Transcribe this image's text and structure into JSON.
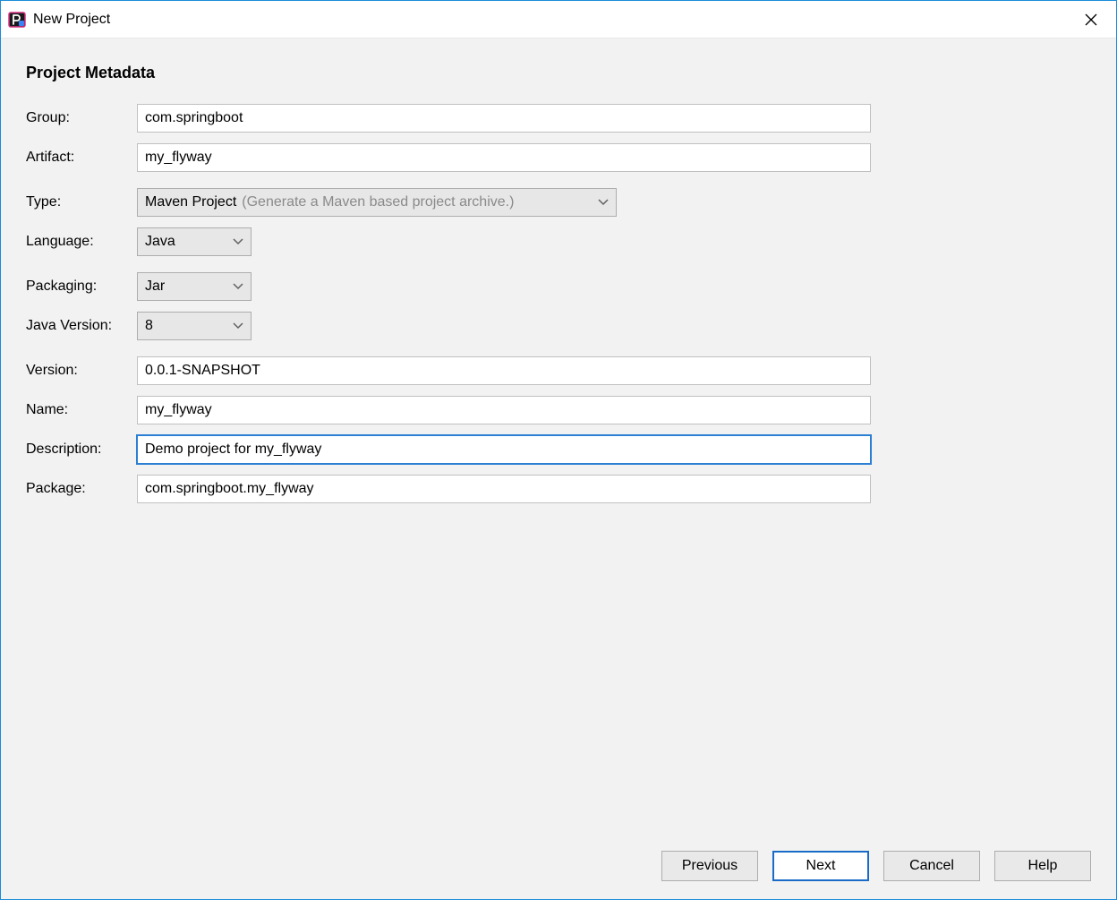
{
  "window": {
    "title": "New Project"
  },
  "section_title": "Project Metadata",
  "labels": {
    "group": "Group:",
    "artifact": "Artifact:",
    "type": "Type:",
    "language": "Language:",
    "packaging": "Packaging:",
    "java_version": "Java Version:",
    "version": "Version:",
    "name": "Name:",
    "description": "Description:",
    "package": "Package:"
  },
  "fields": {
    "group": "com.springboot",
    "artifact": "my_flyway",
    "type_value": "Maven Project",
    "type_hint": "(Generate a Maven based project archive.)",
    "language": "Java",
    "packaging": "Jar",
    "java_version": "8",
    "version": "0.0.1-SNAPSHOT",
    "name": "my_flyway",
    "description": "Demo project for my_flyway",
    "package": "com.springboot.my_flyway"
  },
  "buttons": {
    "previous": "Previous",
    "next": "Next",
    "cancel": "Cancel",
    "help": "Help"
  }
}
